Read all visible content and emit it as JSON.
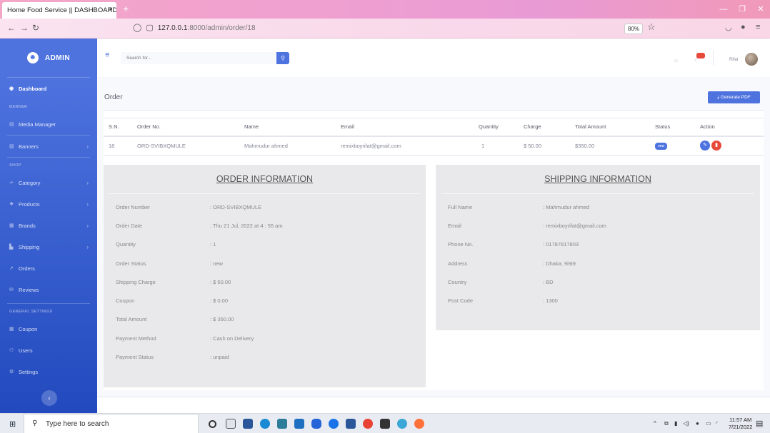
{
  "browser": {
    "tab_title": "Home Food Service || DASHBOARD",
    "tab_close": "×",
    "new_tab": "+",
    "url_host": "127.0.0.1",
    "url_rest": ":8000/admin/order/18",
    "zoom": "80%"
  },
  "sidebar": {
    "brand": "ADMIN",
    "dashboard": "Dashboard",
    "heading_banner": "BANNER",
    "media_manager": "Media Manager",
    "banners": "Banners",
    "heading_shop": "SHOP",
    "category": "Category",
    "products": "Products",
    "brands": "Brands",
    "shipping": "Shipping",
    "orders": "Orders",
    "reviews": "Reviews",
    "heading_general": "GENERAL SETTINGS",
    "coupon": "Coupon",
    "users": "Users",
    "settings": "Settings"
  },
  "topbar": {
    "search_placeholder": "Search for...",
    "user_name": "Rifat"
  },
  "page": {
    "title": "Order",
    "generate_pdf": "⤓ Generate PDF"
  },
  "order_table": {
    "headers": [
      "S.N.",
      "Order No.",
      "Name",
      "Email",
      "Quantity",
      "Charge",
      "Total Amount",
      "Status",
      "Action"
    ],
    "row": {
      "sn": "18",
      "order_no": "ORD-SVIBXQMULE",
      "name": "Mahmudur ahmed",
      "email": "remixboyrifat@gmail.com",
      "quantity": "1",
      "charge": "$ 50.00",
      "total": "$350.00",
      "status": "new"
    }
  },
  "order_info": {
    "title": "ORDER INFORMATION",
    "rows": [
      {
        "label": "Order Number",
        "value": ": ORD-SVIBXQMULE"
      },
      {
        "label": "Order Date",
        "value": ": Thu 21 Jul, 2022 at 4 : 55 am"
      },
      {
        "label": "Quantity",
        "value": ": 1"
      },
      {
        "label": "Order Status",
        "value": ": new"
      },
      {
        "label": "Shipping Charge",
        "value": ": $ 50.00"
      },
      {
        "label": "Coupon",
        "value": ": $ 0.00"
      },
      {
        "label": "Total Amount",
        "value": ": $ 350.00"
      },
      {
        "label": "Payment Method",
        "value": ": Cash on Delivery"
      },
      {
        "label": "Payment Status",
        "value": ": unpaid"
      }
    ]
  },
  "shipping_info": {
    "title": "SHIPPING INFORMATION",
    "rows": [
      {
        "label": "Full Name",
        "value": ": Mahmudur ahmed"
      },
      {
        "label": "Email",
        "value": ": remixboyrifat@gmail.com"
      },
      {
        "label": "Phone No.",
        "value": ": 01787817803"
      },
      {
        "label": "Address",
        "value": ": Dhaka, 9i9i9"
      },
      {
        "label": "Country",
        "value": ": BD"
      },
      {
        "label": "Post Code",
        "value": ": 1300"
      }
    ]
  },
  "taskbar": {
    "search": "Type here to search",
    "time": "11:57 AM",
    "date": "7/21/2022"
  }
}
